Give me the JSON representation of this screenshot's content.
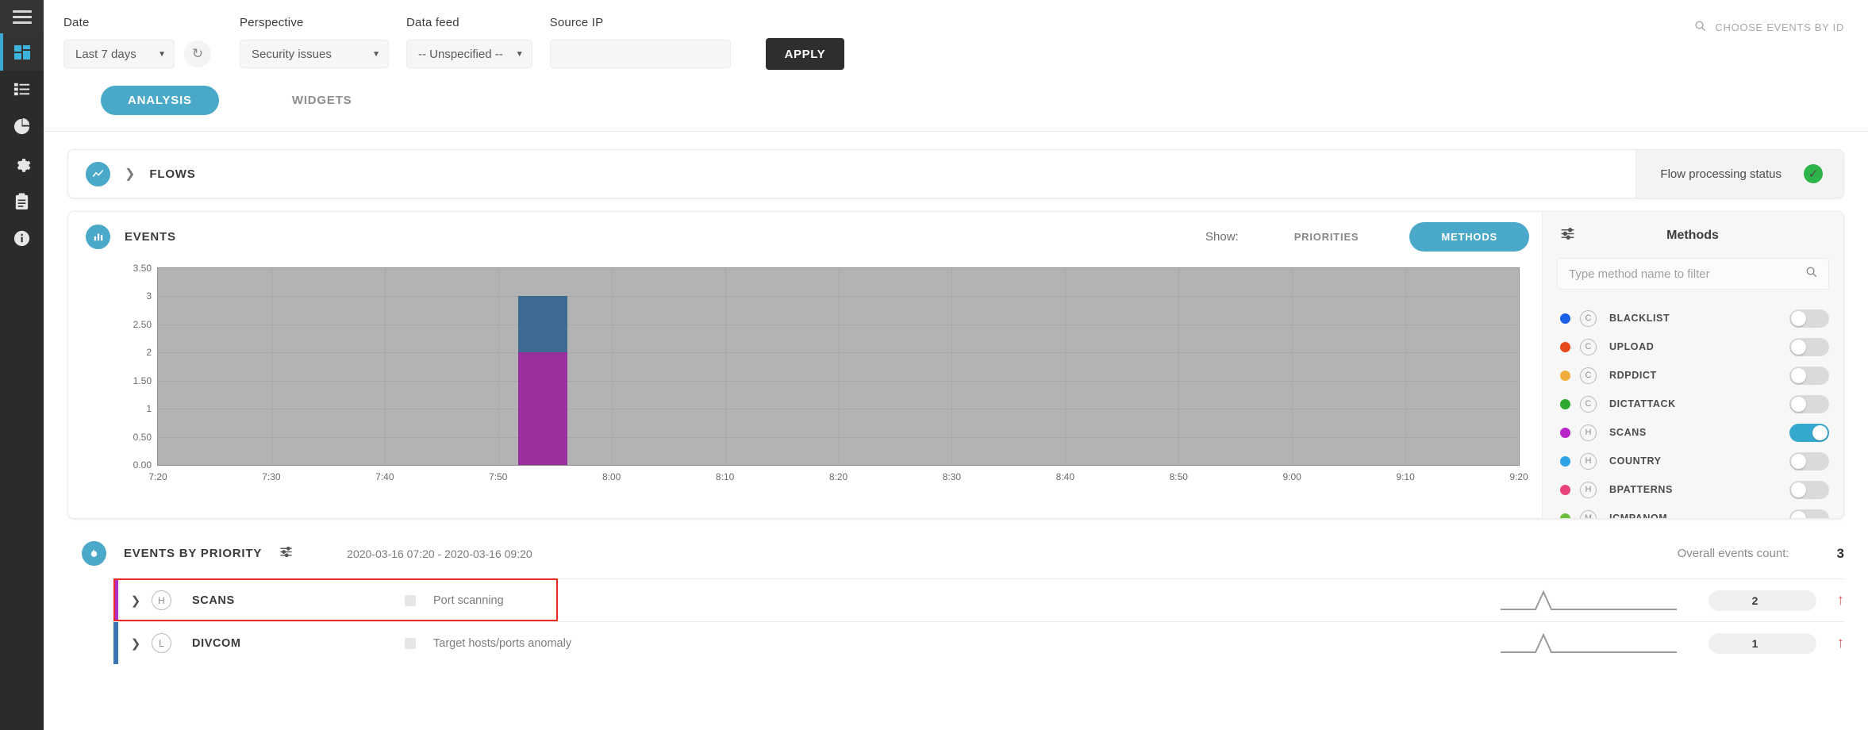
{
  "sidebar": {
    "items": [
      {
        "name": "menu",
        "icon": "hamburger-icon"
      },
      {
        "name": "dashboard",
        "icon": "dashboard-icon",
        "active": true
      },
      {
        "name": "list",
        "icon": "list-icon"
      },
      {
        "name": "reports",
        "icon": "pie-chart-icon"
      },
      {
        "name": "settings",
        "icon": "gear-icon"
      },
      {
        "name": "tasks",
        "icon": "clipboard-icon"
      },
      {
        "name": "info",
        "icon": "info-icon"
      }
    ]
  },
  "filters": {
    "date": {
      "label": "Date",
      "value": "Last 7 days"
    },
    "refresh_icon": "refresh-icon",
    "perspective": {
      "label": "Perspective",
      "value": "Security issues"
    },
    "data_feed": {
      "label": "Data feed",
      "value": "-- Unspecified --"
    },
    "source_ip": {
      "label": "Source IP",
      "value": "",
      "placeholder": ""
    },
    "apply_label": "APPLY",
    "choose_by_id": "CHOOSE EVENTS BY ID",
    "search_icon": "search-icon"
  },
  "tabs": [
    {
      "label": "ANALYSIS",
      "active": true
    },
    {
      "label": "WIDGETS",
      "active": false
    }
  ],
  "flows": {
    "title": "FLOWS",
    "icon": "chart-line-icon",
    "chevron": "chevron-right-icon",
    "status_label": "Flow processing status",
    "status_icon": "check-circle-icon",
    "status_color": "#2eb34a"
  },
  "events": {
    "title": "EVENTS",
    "icon": "bar-chart-icon",
    "show_label": "Show:",
    "segments": [
      {
        "label": "PRIORITIES",
        "active": false
      },
      {
        "label": "METHODS",
        "active": true
      }
    ]
  },
  "chart_data": {
    "type": "bar",
    "title": "EVENTS",
    "xlabel": "",
    "ylabel": "",
    "grid": true,
    "legend_position": "right-panel",
    "x_tick_labels": [
      "7:20",
      "7:30",
      "7:40",
      "7:50",
      "8:00",
      "8:10",
      "8:20",
      "8:30",
      "8:40",
      "8:50",
      "9:00",
      "9:10",
      "9:20"
    ],
    "y_tick_labels": [
      "0.00",
      "0.50",
      "1",
      "1.50",
      "2",
      "2.50",
      "3",
      "3.50"
    ],
    "y_tick_values": [
      0,
      0.5,
      1,
      1.5,
      2,
      2.5,
      3,
      3.5
    ],
    "ylim": [
      0,
      3.5
    ],
    "xlim_minutes": [
      440,
      560
    ],
    "plot_background": "#b3b3b3",
    "stacked": true,
    "bars": [
      {
        "x_label": "7:52",
        "x_fraction": 0.265,
        "width_fraction": 0.036,
        "segments": [
          {
            "name": "SCANS",
            "value": 2,
            "color": "#9c2f9e"
          },
          {
            "name": "DIVCOM",
            "value": 1,
            "color": "#3d6b93"
          }
        ],
        "total": 3
      }
    ],
    "series": [
      {
        "name": "SCANS",
        "color": "#9c2f9e",
        "values": [
          0,
          0,
          0,
          2,
          0,
          0,
          0,
          0,
          0,
          0,
          0,
          0,
          0
        ]
      },
      {
        "name": "DIVCOM",
        "color": "#3d6b93",
        "values": [
          0,
          0,
          0,
          1,
          0,
          0,
          0,
          0,
          0,
          0,
          0,
          0,
          0
        ]
      }
    ],
    "categories": [
      "7:20",
      "7:30",
      "7:40",
      "7:50",
      "8:00",
      "8:10",
      "8:20",
      "8:30",
      "8:40",
      "8:50",
      "9:00",
      "9:10",
      "9:20"
    ]
  },
  "methods_panel": {
    "title": "Methods",
    "settings_icon": "sliders-icon",
    "search_icon": "search-icon",
    "filter_placeholder": "Type method name to filter",
    "filter_value": "",
    "items": [
      {
        "name": "BLACKLIST",
        "badge": "C",
        "color": "#1a61e8",
        "enabled": false
      },
      {
        "name": "UPLOAD",
        "badge": "C",
        "color": "#e8481a",
        "enabled": false
      },
      {
        "name": "RDPDICT",
        "badge": "C",
        "color": "#f0ad3c",
        "enabled": false
      },
      {
        "name": "DICTATTACK",
        "badge": "C",
        "color": "#2fa82f",
        "enabled": false
      },
      {
        "name": "SCANS",
        "badge": "H",
        "color": "#b724c8",
        "enabled": true
      },
      {
        "name": "COUNTRY",
        "badge": "H",
        "color": "#2fa3e8",
        "enabled": false
      },
      {
        "name": "BPATTERNS",
        "badge": "H",
        "color": "#e8437a",
        "enabled": false
      },
      {
        "name": "ICMPANOM",
        "badge": "M",
        "color": "#6cbf3e",
        "enabled": false
      }
    ]
  },
  "events_by_priority": {
    "title": "EVENTS BY PRIORITY",
    "icon": "flame-icon",
    "settings_icon": "sliders-icon",
    "date_range": "2020-03-16 07:20 - 2020-03-16 09:20",
    "count_label": "Overall events count:",
    "count_value": "3",
    "rows": [
      {
        "name": "SCANS",
        "badge": "H",
        "description": "Port scanning",
        "bar_color": "#b32ec4",
        "count": "2",
        "trend": "up",
        "trend_color": "#e4595a",
        "highlighted": true
      },
      {
        "name": "DIVCOM",
        "badge": "L",
        "description": "Target hosts/ports anomaly",
        "bar_color": "#3d74b5",
        "count": "1",
        "trend": "up",
        "trend_color": "#e4595a",
        "highlighted": false
      }
    ]
  }
}
